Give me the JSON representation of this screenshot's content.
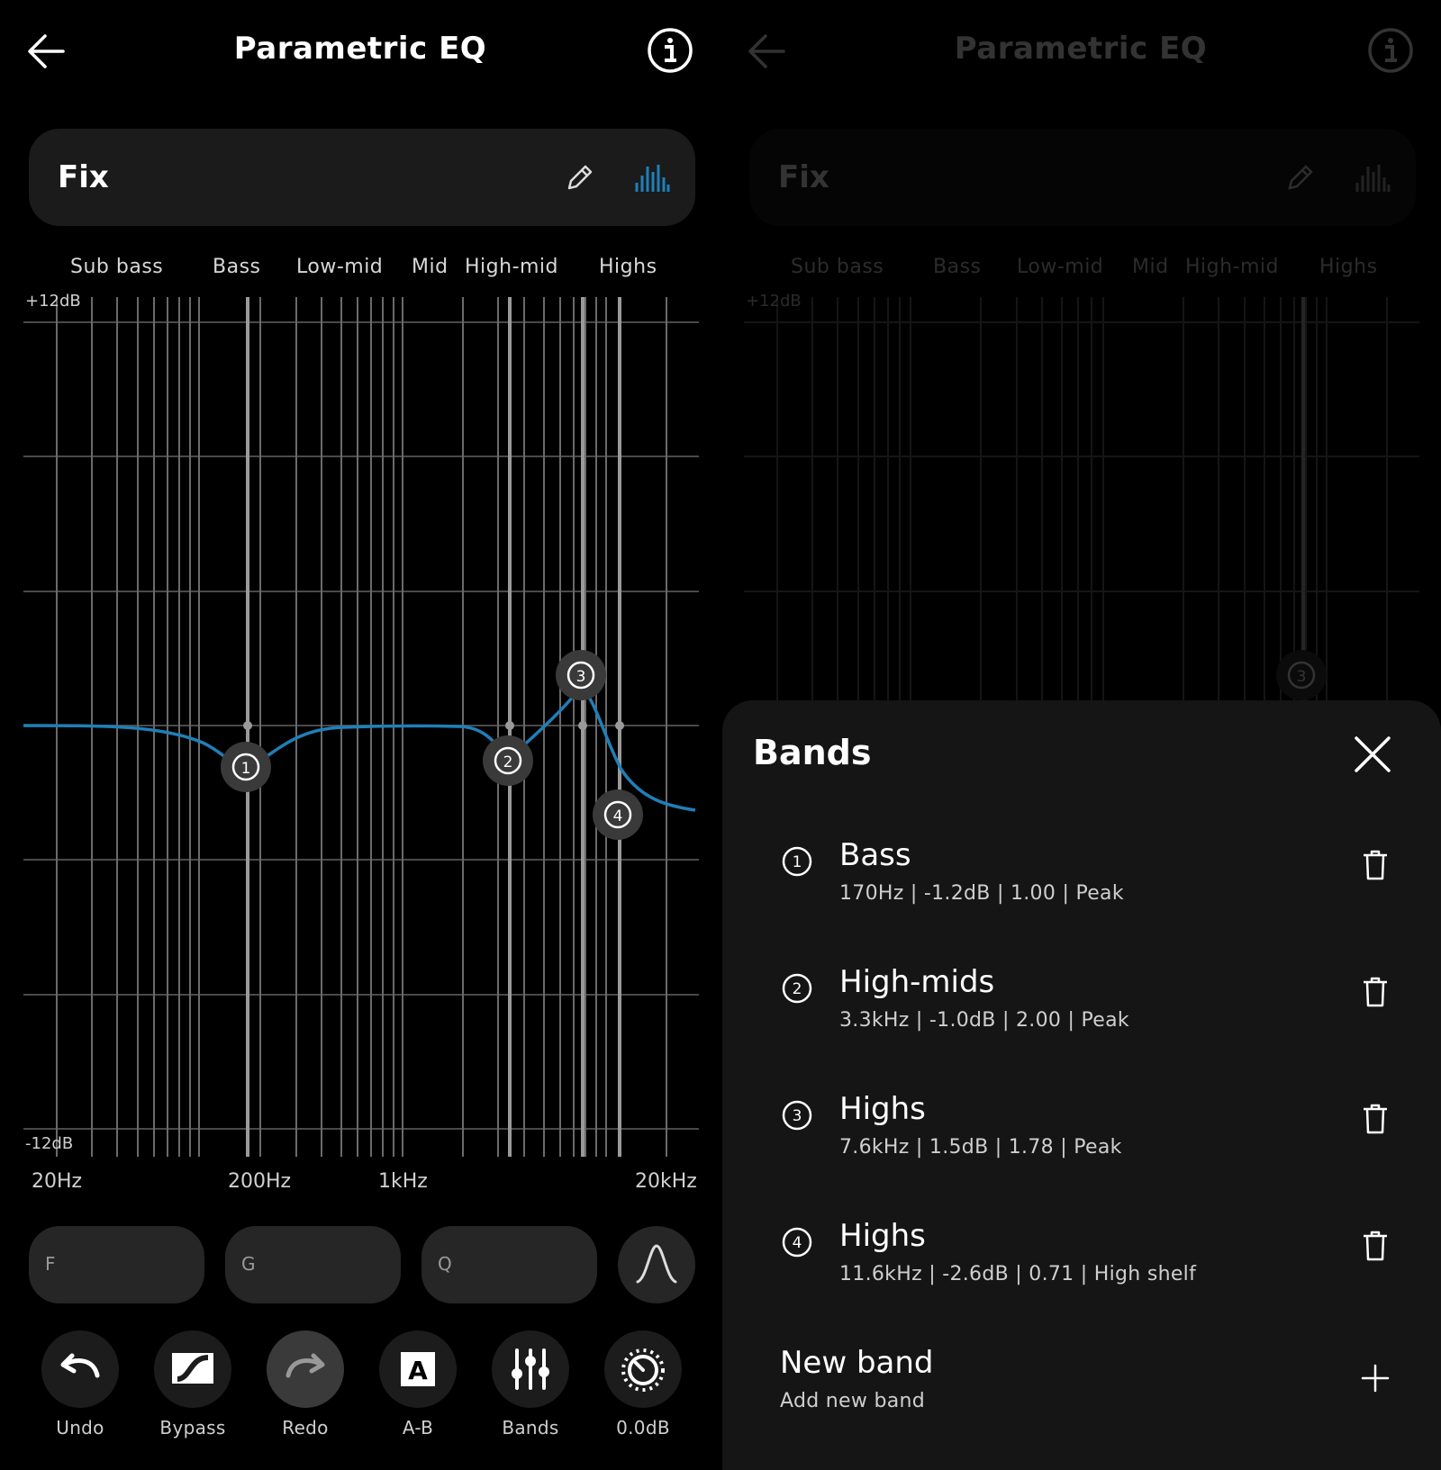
{
  "header": {
    "title": "Parametric EQ"
  },
  "preset": {
    "name": "Fix"
  },
  "regions": [
    "Sub bass",
    "Bass",
    "Low-mid",
    "Mid",
    "High-mid",
    "Highs"
  ],
  "graph": {
    "db_top": "+12dB",
    "db_bottom": "-12dB",
    "freq_labels": [
      "20Hz",
      "200Hz",
      "1kHz",
      "20kHz"
    ],
    "curve_color": "#1f7fb8"
  },
  "inputs": {
    "f": "F",
    "g": "G",
    "q": "Q"
  },
  "toolbar": [
    {
      "label": "Undo",
      "icon": "undo-icon"
    },
    {
      "label": "Bypass",
      "icon": "bypass-icon"
    },
    {
      "label": "Redo",
      "icon": "redo-icon"
    },
    {
      "label": "A-B",
      "icon": "ab-icon"
    },
    {
      "label": "Bands",
      "icon": "sliders-icon"
    },
    {
      "label": "0.0dB",
      "icon": "gain-dial-icon"
    }
  ],
  "sheet": {
    "title": "Bands",
    "bands": [
      {
        "num": "1",
        "name": "Bass",
        "detail": "170Hz | -1.2dB | 1.00 | Peak"
      },
      {
        "num": "2",
        "name": "High-mids",
        "detail": "3.3kHz | -1.0dB | 2.00 | Peak"
      },
      {
        "num": "3",
        "name": "Highs",
        "detail": "7.6kHz | 1.5dB | 1.78 | Peak"
      },
      {
        "num": "4",
        "name": "Highs",
        "detail": "11.6kHz | -2.6dB | 0.71 | High shelf"
      }
    ],
    "new_band": {
      "title": "New band",
      "subtitle": "Add new band"
    }
  },
  "colors": {
    "accent": "#1f7fb8",
    "sheet_bg": "#151515",
    "pill_bg": "#262626"
  }
}
